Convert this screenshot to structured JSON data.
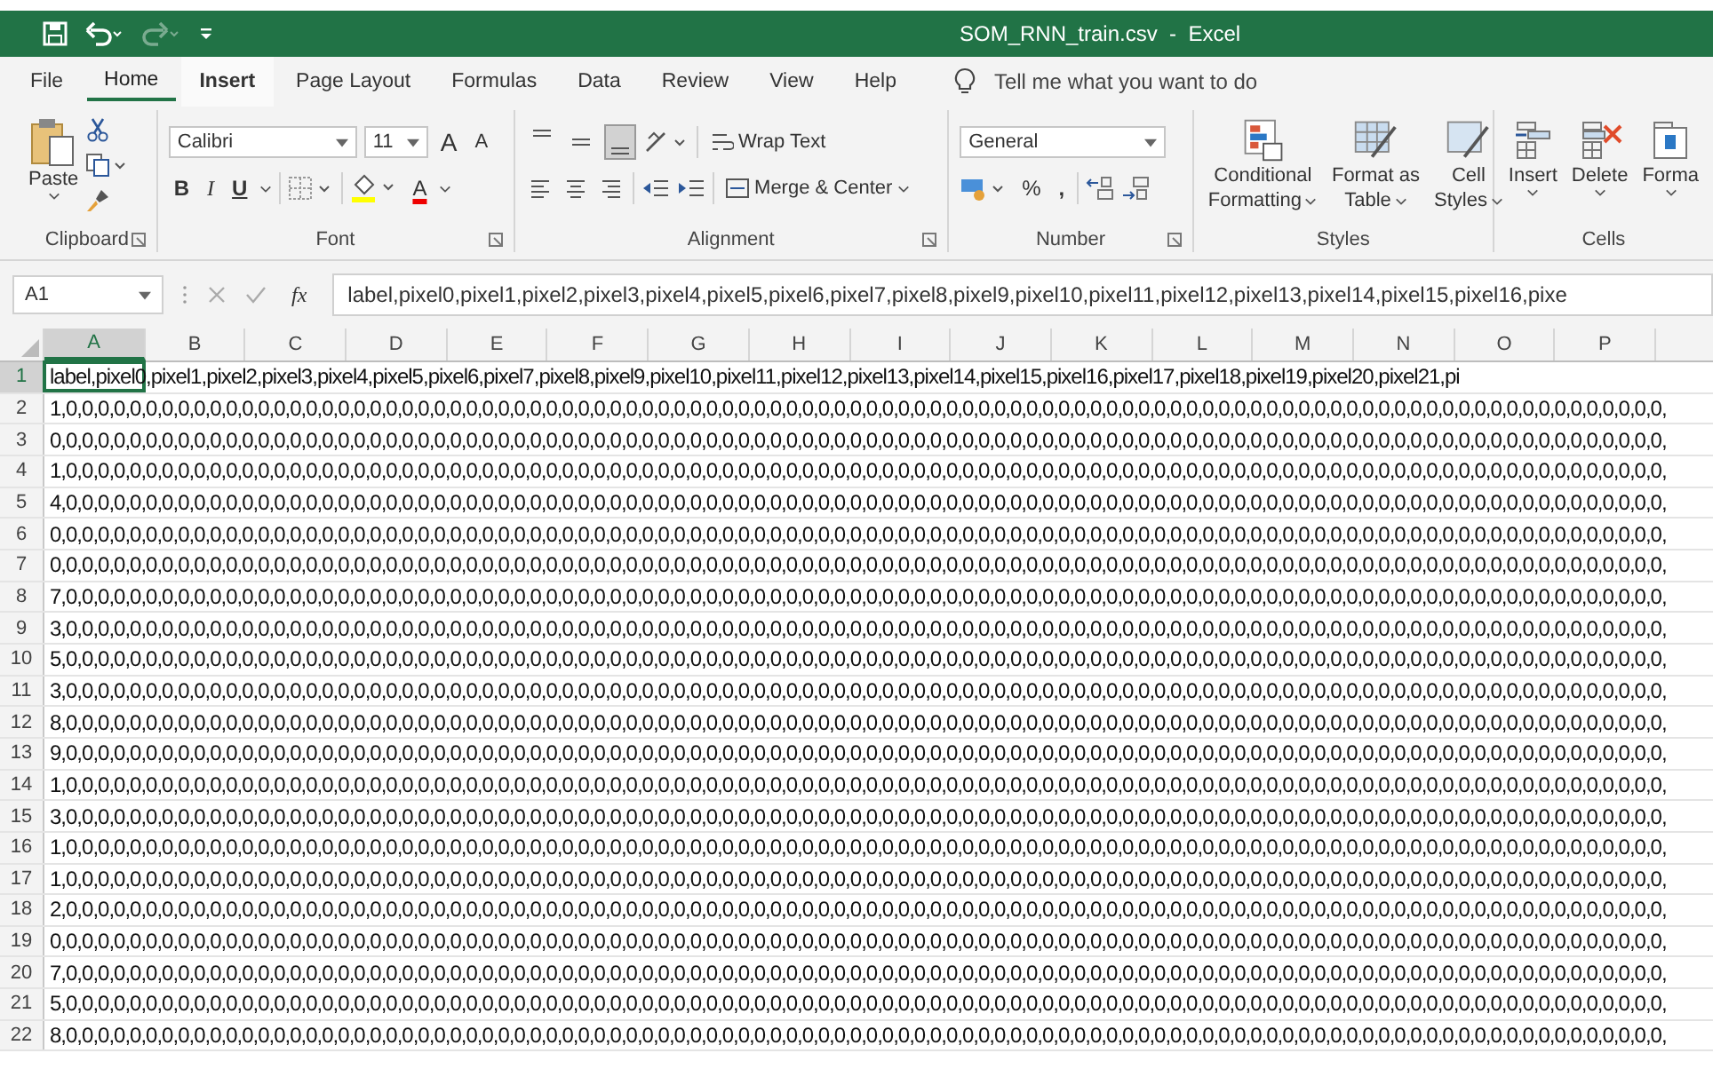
{
  "title_bar": {
    "title": "SOM_RNN_train.csv  -  Excel",
    "redo_disabled": true
  },
  "menu_tabs": [
    {
      "label": "File",
      "selected": false
    },
    {
      "label": "Home",
      "selected": true
    },
    {
      "label": "Insert",
      "selected": false
    },
    {
      "label": "Page Layout",
      "selected": false
    },
    {
      "label": "Formulas",
      "selected": false
    },
    {
      "label": "Data",
      "selected": false
    },
    {
      "label": "Review",
      "selected": false
    },
    {
      "label": "View",
      "selected": false
    },
    {
      "label": "Help",
      "selected": false
    }
  ],
  "tell_me": {
    "placeholder": "Tell me what you want to do"
  },
  "clipboard": {
    "label": "Clipboard",
    "paste": "Paste"
  },
  "font": {
    "label": "Font",
    "family": "Calibri",
    "size": "11",
    "grow": "A",
    "shrink": "A",
    "bold": "B",
    "italic": "I",
    "underline": "U",
    "color_letter": "A"
  },
  "alignment": {
    "label": "Alignment",
    "vertical": [
      {
        "selected": false
      },
      {
        "selected": false
      },
      {
        "selected": true
      }
    ],
    "wrap_text": "Wrap Text",
    "merge": "Merge & Center"
  },
  "number": {
    "label": "Number",
    "format": "General",
    "percent": "%",
    "comma": ","
  },
  "styles": {
    "label": "Styles",
    "buttons": [
      {
        "line1": "Conditional",
        "line2": "Formatting"
      },
      {
        "line1": "Format as",
        "line2": "Table"
      },
      {
        "line1": "Cell",
        "line2": "Styles"
      }
    ]
  },
  "cells": {
    "label": "Cells",
    "buttons": [
      "Insert",
      "Delete",
      "Forma"
    ]
  },
  "formula_bar": {
    "name_box": "A1",
    "fx": "fx",
    "value": "label,pixel0,pixel1,pixel2,pixel3,pixel4,pixel5,pixel6,pixel7,pixel8,pixel9,pixel10,pixel11,pixel12,pixel13,pixel14,pixel15,pixel16,pixe"
  },
  "sheet": {
    "columns": [
      {
        "label": "A",
        "selected": true
      },
      {
        "label": "B",
        "selected": false
      },
      {
        "label": "C",
        "selected": false
      },
      {
        "label": "D",
        "selected": false
      },
      {
        "label": "E",
        "selected": false
      },
      {
        "label": "F",
        "selected": false
      },
      {
        "label": "G",
        "selected": false
      },
      {
        "label": "H",
        "selected": false
      },
      {
        "label": "I",
        "selected": false
      },
      {
        "label": "J",
        "selected": false
      },
      {
        "label": "K",
        "selected": false
      },
      {
        "label": "L",
        "selected": false
      },
      {
        "label": "M",
        "selected": false
      },
      {
        "label": "N",
        "selected": false
      },
      {
        "label": "O",
        "selected": false
      },
      {
        "label": "P",
        "selected": false
      }
    ],
    "rows": [
      {
        "number": "1",
        "selected": true,
        "text": "label,pixel0,pixel1,pixel2,pixel3,pixel4,pixel5,pixel6,pixel7,pixel8,pixel9,pixel10,pixel11,pixel12,pixel13,pixel14,pixel15,pixel16,pixel17,pixel18,pixel19,pixel20,pixel21,pi"
      },
      {
        "number": "2",
        "selected": false,
        "text": "1,0,0,0,0,0,0,0,0,0,0,0,0,0,0,0,0,0,0,0,0,0,0,0,0,0,0,0,0,0,0,0,0,0,0,0,0,0,0,0,0,0,0,0,0,0,0,0,0,0,0,0,0,0,0,0,0,0,0,0,0,0,0,0,0,0,0,0,0,0,0,0,0,0,0,0,0,0,0,0,0,0,0,0,0,0,0,0,0,0,0,0,0,0,0,0,0,0,0,0,0,"
      },
      {
        "number": "3",
        "selected": false,
        "text": "0,0,0,0,0,0,0,0,0,0,0,0,0,0,0,0,0,0,0,0,0,0,0,0,0,0,0,0,0,0,0,0,0,0,0,0,0,0,0,0,0,0,0,0,0,0,0,0,0,0,0,0,0,0,0,0,0,0,0,0,0,0,0,0,0,0,0,0,0,0,0,0,0,0,0,0,0,0,0,0,0,0,0,0,0,0,0,0,0,0,0,0,0,0,0,0,0,0,0,0,0,"
      },
      {
        "number": "4",
        "selected": false,
        "text": "1,0,0,0,0,0,0,0,0,0,0,0,0,0,0,0,0,0,0,0,0,0,0,0,0,0,0,0,0,0,0,0,0,0,0,0,0,0,0,0,0,0,0,0,0,0,0,0,0,0,0,0,0,0,0,0,0,0,0,0,0,0,0,0,0,0,0,0,0,0,0,0,0,0,0,0,0,0,0,0,0,0,0,0,0,0,0,0,0,0,0,0,0,0,0,0,0,0,0,0,0,"
      },
      {
        "number": "5",
        "selected": false,
        "text": "4,0,0,0,0,0,0,0,0,0,0,0,0,0,0,0,0,0,0,0,0,0,0,0,0,0,0,0,0,0,0,0,0,0,0,0,0,0,0,0,0,0,0,0,0,0,0,0,0,0,0,0,0,0,0,0,0,0,0,0,0,0,0,0,0,0,0,0,0,0,0,0,0,0,0,0,0,0,0,0,0,0,0,0,0,0,0,0,0,0,0,0,0,0,0,0,0,0,0,0,0,"
      },
      {
        "number": "6",
        "selected": false,
        "text": "0,0,0,0,0,0,0,0,0,0,0,0,0,0,0,0,0,0,0,0,0,0,0,0,0,0,0,0,0,0,0,0,0,0,0,0,0,0,0,0,0,0,0,0,0,0,0,0,0,0,0,0,0,0,0,0,0,0,0,0,0,0,0,0,0,0,0,0,0,0,0,0,0,0,0,0,0,0,0,0,0,0,0,0,0,0,0,0,0,0,0,0,0,0,0,0,0,0,0,0,0,"
      },
      {
        "number": "7",
        "selected": false,
        "text": "0,0,0,0,0,0,0,0,0,0,0,0,0,0,0,0,0,0,0,0,0,0,0,0,0,0,0,0,0,0,0,0,0,0,0,0,0,0,0,0,0,0,0,0,0,0,0,0,0,0,0,0,0,0,0,0,0,0,0,0,0,0,0,0,0,0,0,0,0,0,0,0,0,0,0,0,0,0,0,0,0,0,0,0,0,0,0,0,0,0,0,0,0,0,0,0,0,0,0,0,0,"
      },
      {
        "number": "8",
        "selected": false,
        "text": "7,0,0,0,0,0,0,0,0,0,0,0,0,0,0,0,0,0,0,0,0,0,0,0,0,0,0,0,0,0,0,0,0,0,0,0,0,0,0,0,0,0,0,0,0,0,0,0,0,0,0,0,0,0,0,0,0,0,0,0,0,0,0,0,0,0,0,0,0,0,0,0,0,0,0,0,0,0,0,0,0,0,0,0,0,0,0,0,0,0,0,0,0,0,0,0,0,0,0,0,0,"
      },
      {
        "number": "9",
        "selected": false,
        "text": "3,0,0,0,0,0,0,0,0,0,0,0,0,0,0,0,0,0,0,0,0,0,0,0,0,0,0,0,0,0,0,0,0,0,0,0,0,0,0,0,0,0,0,0,0,0,0,0,0,0,0,0,0,0,0,0,0,0,0,0,0,0,0,0,0,0,0,0,0,0,0,0,0,0,0,0,0,0,0,0,0,0,0,0,0,0,0,0,0,0,0,0,0,0,0,0,0,0,0,0,0,"
      },
      {
        "number": "10",
        "selected": false,
        "text": "5,0,0,0,0,0,0,0,0,0,0,0,0,0,0,0,0,0,0,0,0,0,0,0,0,0,0,0,0,0,0,0,0,0,0,0,0,0,0,0,0,0,0,0,0,0,0,0,0,0,0,0,0,0,0,0,0,0,0,0,0,0,0,0,0,0,0,0,0,0,0,0,0,0,0,0,0,0,0,0,0,0,0,0,0,0,0,0,0,0,0,0,0,0,0,0,0,0,0,0,0,"
      },
      {
        "number": "11",
        "selected": false,
        "text": "3,0,0,0,0,0,0,0,0,0,0,0,0,0,0,0,0,0,0,0,0,0,0,0,0,0,0,0,0,0,0,0,0,0,0,0,0,0,0,0,0,0,0,0,0,0,0,0,0,0,0,0,0,0,0,0,0,0,0,0,0,0,0,0,0,0,0,0,0,0,0,0,0,0,0,0,0,0,0,0,0,0,0,0,0,0,0,0,0,0,0,0,0,0,0,0,0,0,0,0,0,"
      },
      {
        "number": "12",
        "selected": false,
        "text": "8,0,0,0,0,0,0,0,0,0,0,0,0,0,0,0,0,0,0,0,0,0,0,0,0,0,0,0,0,0,0,0,0,0,0,0,0,0,0,0,0,0,0,0,0,0,0,0,0,0,0,0,0,0,0,0,0,0,0,0,0,0,0,0,0,0,0,0,0,0,0,0,0,0,0,0,0,0,0,0,0,0,0,0,0,0,0,0,0,0,0,0,0,0,0,0,0,0,0,0,0,"
      },
      {
        "number": "13",
        "selected": false,
        "text": "9,0,0,0,0,0,0,0,0,0,0,0,0,0,0,0,0,0,0,0,0,0,0,0,0,0,0,0,0,0,0,0,0,0,0,0,0,0,0,0,0,0,0,0,0,0,0,0,0,0,0,0,0,0,0,0,0,0,0,0,0,0,0,0,0,0,0,0,0,0,0,0,0,0,0,0,0,0,0,0,0,0,0,0,0,0,0,0,0,0,0,0,0,0,0,0,0,0,0,0,0,"
      },
      {
        "number": "14",
        "selected": false,
        "text": "1,0,0,0,0,0,0,0,0,0,0,0,0,0,0,0,0,0,0,0,0,0,0,0,0,0,0,0,0,0,0,0,0,0,0,0,0,0,0,0,0,0,0,0,0,0,0,0,0,0,0,0,0,0,0,0,0,0,0,0,0,0,0,0,0,0,0,0,0,0,0,0,0,0,0,0,0,0,0,0,0,0,0,0,0,0,0,0,0,0,0,0,0,0,0,0,0,0,0,0,0,"
      },
      {
        "number": "15",
        "selected": false,
        "text": "3,0,0,0,0,0,0,0,0,0,0,0,0,0,0,0,0,0,0,0,0,0,0,0,0,0,0,0,0,0,0,0,0,0,0,0,0,0,0,0,0,0,0,0,0,0,0,0,0,0,0,0,0,0,0,0,0,0,0,0,0,0,0,0,0,0,0,0,0,0,0,0,0,0,0,0,0,0,0,0,0,0,0,0,0,0,0,0,0,0,0,0,0,0,0,0,0,0,0,0,0,"
      },
      {
        "number": "16",
        "selected": false,
        "text": "1,0,0,0,0,0,0,0,0,0,0,0,0,0,0,0,0,0,0,0,0,0,0,0,0,0,0,0,0,0,0,0,0,0,0,0,0,0,0,0,0,0,0,0,0,0,0,0,0,0,0,0,0,0,0,0,0,0,0,0,0,0,0,0,0,0,0,0,0,0,0,0,0,0,0,0,0,0,0,0,0,0,0,0,0,0,0,0,0,0,0,0,0,0,0,0,0,0,0,0,0,"
      },
      {
        "number": "17",
        "selected": false,
        "text": "1,0,0,0,0,0,0,0,0,0,0,0,0,0,0,0,0,0,0,0,0,0,0,0,0,0,0,0,0,0,0,0,0,0,0,0,0,0,0,0,0,0,0,0,0,0,0,0,0,0,0,0,0,0,0,0,0,0,0,0,0,0,0,0,0,0,0,0,0,0,0,0,0,0,0,0,0,0,0,0,0,0,0,0,0,0,0,0,0,0,0,0,0,0,0,0,0,0,0,0,0,"
      },
      {
        "number": "18",
        "selected": false,
        "text": "2,0,0,0,0,0,0,0,0,0,0,0,0,0,0,0,0,0,0,0,0,0,0,0,0,0,0,0,0,0,0,0,0,0,0,0,0,0,0,0,0,0,0,0,0,0,0,0,0,0,0,0,0,0,0,0,0,0,0,0,0,0,0,0,0,0,0,0,0,0,0,0,0,0,0,0,0,0,0,0,0,0,0,0,0,0,0,0,0,0,0,0,0,0,0,0,0,0,0,0,0,"
      },
      {
        "number": "19",
        "selected": false,
        "text": "0,0,0,0,0,0,0,0,0,0,0,0,0,0,0,0,0,0,0,0,0,0,0,0,0,0,0,0,0,0,0,0,0,0,0,0,0,0,0,0,0,0,0,0,0,0,0,0,0,0,0,0,0,0,0,0,0,0,0,0,0,0,0,0,0,0,0,0,0,0,0,0,0,0,0,0,0,0,0,0,0,0,0,0,0,0,0,0,0,0,0,0,0,0,0,0,0,0,0,0,0,"
      },
      {
        "number": "20",
        "selected": false,
        "text": "7,0,0,0,0,0,0,0,0,0,0,0,0,0,0,0,0,0,0,0,0,0,0,0,0,0,0,0,0,0,0,0,0,0,0,0,0,0,0,0,0,0,0,0,0,0,0,0,0,0,0,0,0,0,0,0,0,0,0,0,0,0,0,0,0,0,0,0,0,0,0,0,0,0,0,0,0,0,0,0,0,0,0,0,0,0,0,0,0,0,0,0,0,0,0,0,0,0,0,0,0,"
      },
      {
        "number": "21",
        "selected": false,
        "text": "5,0,0,0,0,0,0,0,0,0,0,0,0,0,0,0,0,0,0,0,0,0,0,0,0,0,0,0,0,0,0,0,0,0,0,0,0,0,0,0,0,0,0,0,0,0,0,0,0,0,0,0,0,0,0,0,0,0,0,0,0,0,0,0,0,0,0,0,0,0,0,0,0,0,0,0,0,0,0,0,0,0,0,0,0,0,0,0,0,0,0,0,0,0,0,0,0,0,0,0,0,"
      },
      {
        "number": "22",
        "selected": false,
        "text": "8,0,0,0,0,0,0,0,0,0,0,0,0,0,0,0,0,0,0,0,0,0,0,0,0,0,0,0,0,0,0,0,0,0,0,0,0,0,0,0,0,0,0,0,0,0,0,0,0,0,0,0,0,0,0,0,0,0,0,0,0,0,0,0,0,0,0,0,0,0,0,0,0,0,0,0,0,0,0,0,0,0,0,0,0,0,0,0,0,0,0,0,0,0,0,0,0,0,0,0,0,"
      }
    ]
  }
}
